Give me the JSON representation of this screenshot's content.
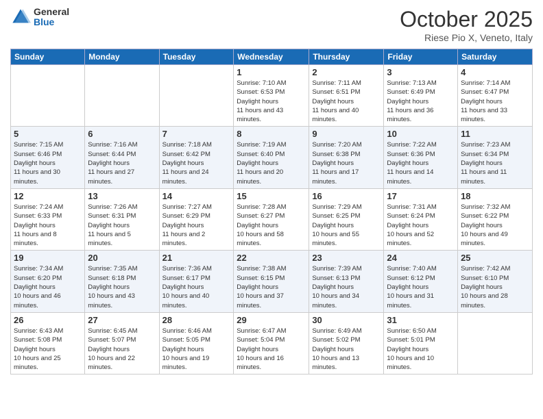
{
  "logo": {
    "general": "General",
    "blue": "Blue"
  },
  "title": "October 2025",
  "subtitle": "Riese Pio X, Veneto, Italy",
  "days_header": [
    "Sunday",
    "Monday",
    "Tuesday",
    "Wednesday",
    "Thursday",
    "Friday",
    "Saturday"
  ],
  "weeks": [
    [
      {
        "day": "",
        "empty": true
      },
      {
        "day": "",
        "empty": true
      },
      {
        "day": "",
        "empty": true
      },
      {
        "day": "1",
        "sunrise": "7:10 AM",
        "sunset": "6:53 PM",
        "daylight": "11 hours and 43 minutes."
      },
      {
        "day": "2",
        "sunrise": "7:11 AM",
        "sunset": "6:51 PM",
        "daylight": "11 hours and 40 minutes."
      },
      {
        "day": "3",
        "sunrise": "7:13 AM",
        "sunset": "6:49 PM",
        "daylight": "11 hours and 36 minutes."
      },
      {
        "day": "4",
        "sunrise": "7:14 AM",
        "sunset": "6:47 PM",
        "daylight": "11 hours and 33 minutes."
      }
    ],
    [
      {
        "day": "5",
        "sunrise": "7:15 AM",
        "sunset": "6:46 PM",
        "daylight": "11 hours and 30 minutes."
      },
      {
        "day": "6",
        "sunrise": "7:16 AM",
        "sunset": "6:44 PM",
        "daylight": "11 hours and 27 minutes."
      },
      {
        "day": "7",
        "sunrise": "7:18 AM",
        "sunset": "6:42 PM",
        "daylight": "11 hours and 24 minutes."
      },
      {
        "day": "8",
        "sunrise": "7:19 AM",
        "sunset": "6:40 PM",
        "daylight": "11 hours and 20 minutes."
      },
      {
        "day": "9",
        "sunrise": "7:20 AM",
        "sunset": "6:38 PM",
        "daylight": "11 hours and 17 minutes."
      },
      {
        "day": "10",
        "sunrise": "7:22 AM",
        "sunset": "6:36 PM",
        "daylight": "11 hours and 14 minutes."
      },
      {
        "day": "11",
        "sunrise": "7:23 AM",
        "sunset": "6:34 PM",
        "daylight": "11 hours and 11 minutes."
      }
    ],
    [
      {
        "day": "12",
        "sunrise": "7:24 AM",
        "sunset": "6:33 PM",
        "daylight": "11 hours and 8 minutes."
      },
      {
        "day": "13",
        "sunrise": "7:26 AM",
        "sunset": "6:31 PM",
        "daylight": "11 hours and 5 minutes."
      },
      {
        "day": "14",
        "sunrise": "7:27 AM",
        "sunset": "6:29 PM",
        "daylight": "11 hours and 2 minutes."
      },
      {
        "day": "15",
        "sunrise": "7:28 AM",
        "sunset": "6:27 PM",
        "daylight": "10 hours and 58 minutes."
      },
      {
        "day": "16",
        "sunrise": "7:29 AM",
        "sunset": "6:25 PM",
        "daylight": "10 hours and 55 minutes."
      },
      {
        "day": "17",
        "sunrise": "7:31 AM",
        "sunset": "6:24 PM",
        "daylight": "10 hours and 52 minutes."
      },
      {
        "day": "18",
        "sunrise": "7:32 AM",
        "sunset": "6:22 PM",
        "daylight": "10 hours and 49 minutes."
      }
    ],
    [
      {
        "day": "19",
        "sunrise": "7:34 AM",
        "sunset": "6:20 PM",
        "daylight": "10 hours and 46 minutes."
      },
      {
        "day": "20",
        "sunrise": "7:35 AM",
        "sunset": "6:18 PM",
        "daylight": "10 hours and 43 minutes."
      },
      {
        "day": "21",
        "sunrise": "7:36 AM",
        "sunset": "6:17 PM",
        "daylight": "10 hours and 40 minutes."
      },
      {
        "day": "22",
        "sunrise": "7:38 AM",
        "sunset": "6:15 PM",
        "daylight": "10 hours and 37 minutes."
      },
      {
        "day": "23",
        "sunrise": "7:39 AM",
        "sunset": "6:13 PM",
        "daylight": "10 hours and 34 minutes."
      },
      {
        "day": "24",
        "sunrise": "7:40 AM",
        "sunset": "6:12 PM",
        "daylight": "10 hours and 31 minutes."
      },
      {
        "day": "25",
        "sunrise": "7:42 AM",
        "sunset": "6:10 PM",
        "daylight": "10 hours and 28 minutes."
      }
    ],
    [
      {
        "day": "26",
        "sunrise": "6:43 AM",
        "sunset": "5:08 PM",
        "daylight": "10 hours and 25 minutes."
      },
      {
        "day": "27",
        "sunrise": "6:45 AM",
        "sunset": "5:07 PM",
        "daylight": "10 hours and 22 minutes."
      },
      {
        "day": "28",
        "sunrise": "6:46 AM",
        "sunset": "5:05 PM",
        "daylight": "10 hours and 19 minutes."
      },
      {
        "day": "29",
        "sunrise": "6:47 AM",
        "sunset": "5:04 PM",
        "daylight": "10 hours and 16 minutes."
      },
      {
        "day": "30",
        "sunrise": "6:49 AM",
        "sunset": "5:02 PM",
        "daylight": "10 hours and 13 minutes."
      },
      {
        "day": "31",
        "sunrise": "6:50 AM",
        "sunset": "5:01 PM",
        "daylight": "10 hours and 10 minutes."
      },
      {
        "day": "",
        "empty": true
      }
    ]
  ],
  "labels": {
    "sunrise": "Sunrise:",
    "sunset": "Sunset:",
    "daylight": "Daylight hours"
  }
}
